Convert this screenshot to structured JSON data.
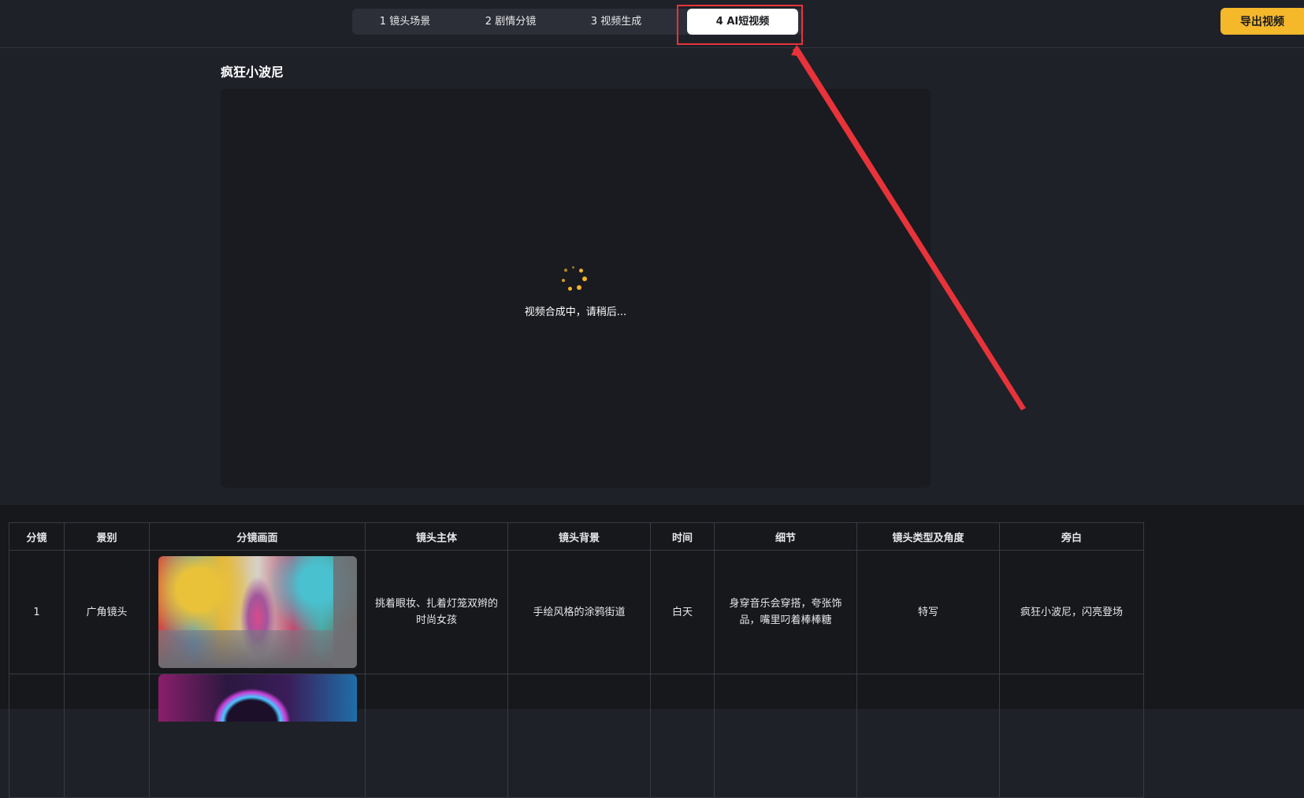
{
  "steps": [
    {
      "label": "1 镜头场景"
    },
    {
      "label": "2 剧情分镜"
    },
    {
      "label": "3 视频生成"
    },
    {
      "label": "4 AI短视频"
    }
  ],
  "active_step": "4 AI短视频",
  "export_label": "导出视频",
  "video": {
    "title": "疯狂小波尼",
    "loading_text": "视频合成中，请稍后..."
  },
  "table": {
    "headers": [
      "分镜",
      "景别",
      "分镜画面",
      "镜头主体",
      "镜头背景",
      "时间",
      "细节",
      "镜头类型及角度",
      "旁白"
    ],
    "rows": [
      {
        "index": "1",
        "shot_size": "广角镜头",
        "subject": "挑着眼妆、扎着灯笼双辫的时尚女孩",
        "background": "手绘风格的涂鸦街道",
        "time": "白天",
        "detail": "身穿音乐会穿搭，夸张饰品，嘴里叼着棒棒糖",
        "camera": "特写",
        "narration": "疯狂小波尼，闪亮登场"
      },
      {
        "index": "",
        "shot_size": "",
        "subject": "",
        "background": "",
        "time": "",
        "detail": "",
        "camera": "",
        "narration": ""
      }
    ]
  },
  "colors": {
    "accent": "#f5b82b",
    "annotation": "#e8333a",
    "background": "#1f2129"
  }
}
